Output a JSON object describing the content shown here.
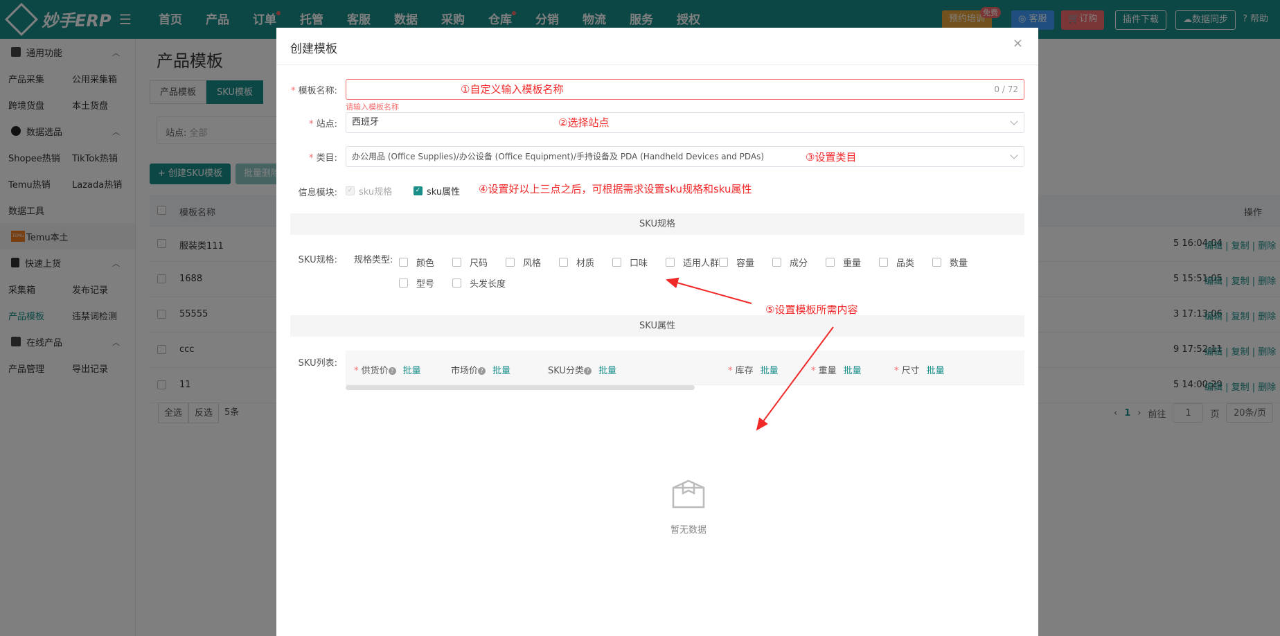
{
  "app": {
    "brand": "妙手ERP"
  },
  "nav": [
    "首页",
    "产品",
    "订单",
    "托管",
    "客服",
    "数据",
    "采购",
    "仓库",
    "分销",
    "物流",
    "服务",
    "授权"
  ],
  "top_buttons": {
    "training": "预约培训",
    "free_badge": "免费",
    "service": "客服",
    "order": "订购",
    "plugin": "插件下载",
    "sync": "数据同步",
    "help": "帮助"
  },
  "sidebar": {
    "groups": [
      {
        "title": "通用功能",
        "items": [
          [
            "产品采集",
            "公用采集箱"
          ],
          [
            "跨境货盘",
            "本土货盘"
          ]
        ]
      },
      {
        "title": "数据选品",
        "items": [
          [
            "Shopee热销",
            "TikTok热销"
          ],
          [
            "Temu热销",
            "Lazada热销"
          ],
          [
            "数据工具",
            ""
          ]
        ]
      },
      {
        "title": "快速上货",
        "items": [
          [
            "采集箱",
            "发布记录"
          ],
          [
            "产品模板",
            "违禁词检测"
          ]
        ]
      },
      {
        "title": "在线产品",
        "items": [
          [
            "产品管理",
            "导出记录"
          ]
        ]
      }
    ],
    "temu_local": "Temu本土",
    "temu_logo": "TEMU"
  },
  "main": {
    "page_title": "产品模板",
    "tabs": [
      "产品模板",
      "SKU模板"
    ],
    "filter": {
      "label": "站点:",
      "value": "全部"
    },
    "create_button": "+ 创建SKU模板",
    "batch_button": "批量删除",
    "table": {
      "col_name": "模板名称",
      "col_ops": "操作",
      "rows": [
        {
          "name": "服装类111",
          "time": "5 16:04:04"
        },
        {
          "name": "1688",
          "time": "5 15:51:05"
        },
        {
          "name": "55555",
          "time": "3 17:13:06"
        },
        {
          "name": "ccc",
          "time": "9 17:52:11"
        },
        {
          "name": "11",
          "time": "5 14:00:29"
        }
      ],
      "ops": "编辑 | 复制 | 删除"
    },
    "pager": {
      "select_all": "全选",
      "invert": "反选",
      "count": "5条",
      "prev": "‹",
      "page": "1",
      "next": "›",
      "goto": "前往",
      "page_input": "1",
      "page_suffix": "页",
      "page_size": "20条/页"
    }
  },
  "modal": {
    "title": "创建模板",
    "close": "×",
    "name_label": "模板名称:",
    "name_counter": "0 / 72",
    "name_error": "请输入模板名称",
    "site_label": "站点:",
    "site_value": "西班牙",
    "category_label": "类目:",
    "category_value": "办公用品 (Office Supplies)/办公设备 (Office Equipment)/手持设备及 PDA (Handheld Devices and PDAs)",
    "info_label": "信息模块:",
    "info_sku_spec": "sku规格",
    "info_sku_attr": "sku属性",
    "section_spec": "SKU规格",
    "spec_label": "SKU规格:",
    "spec_type_label": "规格类型:",
    "spec_options": [
      "颜色",
      "尺码",
      "风格",
      "材质",
      "口味",
      "适用人群",
      "容量",
      "成分",
      "重量",
      "品类",
      "数量",
      "型号",
      "头发长度"
    ],
    "section_attr": "SKU属性",
    "list_label": "SKU列表:",
    "sku_columns": {
      "supply": "供货价",
      "market": "市场价",
      "category": "SKU分类",
      "stock": "库存",
      "weight": "重量",
      "size": "尺寸",
      "batch": "批量"
    },
    "empty_text": "暂无数据"
  },
  "annotations": {
    "a1": "①自定义输入模板名称",
    "a2": "②选择站点",
    "a3": "③设置类目",
    "a4": "④设置好以上三点之后，可根据需求设置sku规格和sku属性",
    "a5": "⑤设置模板所需内容"
  },
  "colors": {
    "brand": "#1a8f8a",
    "required": "#f56c6c",
    "annotation": "#f02828"
  }
}
